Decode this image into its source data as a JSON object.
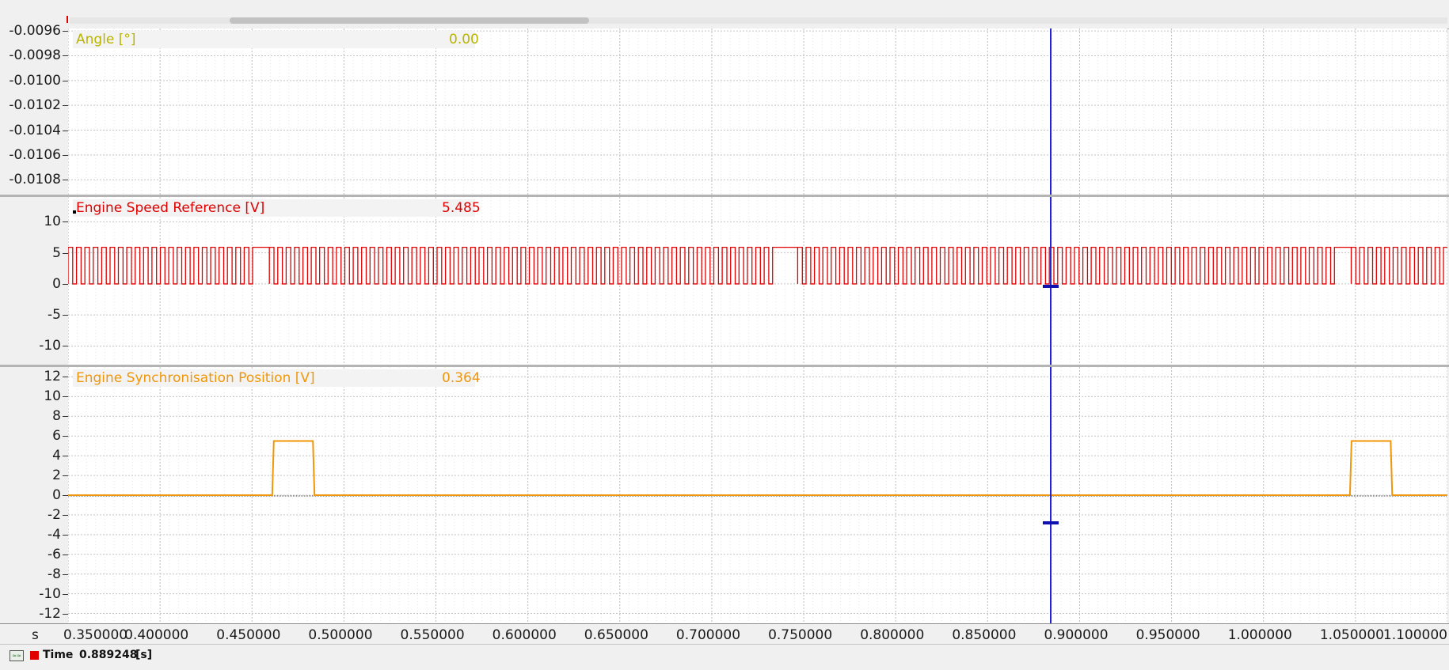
{
  "time_cursor": {
    "label": "Time",
    "value": "0.889248",
    "unit": "[s]"
  },
  "x_axis": {
    "unit_label": "s",
    "range": [
      0.35,
      1.1
    ],
    "ticks": [
      {
        "value": 0.35,
        "label": "0.350000"
      },
      {
        "value": 0.4,
        "label": "0.400000"
      },
      {
        "value": 0.45,
        "label": "0.450000"
      },
      {
        "value": 0.5,
        "label": "0.500000"
      },
      {
        "value": 0.55,
        "label": "0.550000"
      },
      {
        "value": 0.6,
        "label": "0.600000"
      },
      {
        "value": 0.65,
        "label": "0.650000"
      },
      {
        "value": 0.7,
        "label": "0.700000"
      },
      {
        "value": 0.75,
        "label": "0.750000"
      },
      {
        "value": 0.8,
        "label": "0.800000"
      },
      {
        "value": 0.85,
        "label": "0.850000"
      },
      {
        "value": 0.9,
        "label": "0.900000"
      },
      {
        "value": 0.95,
        "label": "0.950000"
      },
      {
        "value": 1.0,
        "label": "1.000000"
      },
      {
        "value": 1.05,
        "label": "1.050000"
      },
      {
        "value": 1.1,
        "label": "1.100000"
      }
    ]
  },
  "panels": [
    {
      "name": "Angle [°]",
      "value": "0.00",
      "color": "#b8b400",
      "y_ticks": [
        "-0.0096",
        "-0.0098",
        "-0.0100",
        "-0.0102",
        "-0.0104",
        "-0.0106",
        "-0.0108"
      ]
    },
    {
      "name": "Engine Speed Reference [V]",
      "value": "5.485",
      "color": "#e00000",
      "y_ticks": [
        "10",
        "5",
        "0",
        "-5",
        "-10"
      ]
    },
    {
      "name": "Engine Synchronisation Position [V]",
      "value": "0.364",
      "color": "#f0960a",
      "y_ticks": [
        "12",
        "10",
        "8",
        "6",
        "4",
        "2",
        "0",
        "-2",
        "-4",
        "-6",
        "-8",
        "-10",
        "-12"
      ]
    }
  ],
  "chart_data": [
    {
      "type": "line",
      "series": [
        {
          "name": "Angle [°]",
          "x": [],
          "y": []
        }
      ],
      "ylim": [
        -0.01092,
        -0.00958
      ],
      "xlim": [
        0.35,
        1.1
      ],
      "grid": true
    },
    {
      "type": "line",
      "series": [
        {
          "name": "Engine Speed Reference [V]",
          "pulse_train": {
            "low": 0,
            "high": 5.9,
            "period_s": 0.00456,
            "missing_tooth_gaps": [
              [
                0.449,
                0.459
              ],
              [
                0.733,
                0.743
              ],
              [
                1.035,
                1.045
              ]
            ]
          }
        }
      ],
      "ylim": [
        -13,
        14
      ],
      "xlim": [
        0.35,
        1.1
      ],
      "grid": true
    },
    {
      "type": "line",
      "series": [
        {
          "name": "Engine Synchronisation Position [V]",
          "baseline": 0,
          "pulses": [
            {
              "start": 0.461,
              "end": 0.484,
              "level": 5.5
            },
            {
              "start": 1.047,
              "end": 1.07,
              "level": 5.5
            }
          ]
        }
      ],
      "ylim": [
        -13,
        13
      ],
      "xlim": [
        0.35,
        1.1
      ],
      "grid": true
    }
  ]
}
